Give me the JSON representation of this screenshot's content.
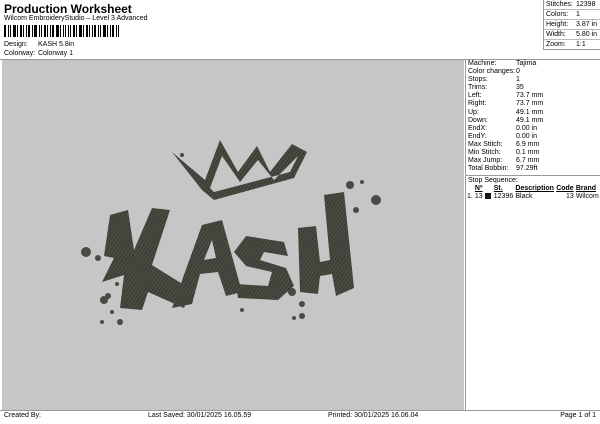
{
  "header": {
    "title": "Production Worksheet",
    "subtitle": "Wilcom EmbroideryStudio – Level 3 Advanced",
    "design_label": "Design:",
    "design_value": "KASH 5.8in",
    "colorway_label": "Colorway:",
    "colorway_value": "Colorway 1"
  },
  "stats": [
    {
      "label": "Stitches:",
      "value": "12398"
    },
    {
      "label": "Colors:",
      "value": "1"
    },
    {
      "label": "Height:",
      "value": "3.87 in"
    },
    {
      "label": "Width:",
      "value": "5.80 in"
    },
    {
      "label": "Zoom:",
      "value": "1:1"
    }
  ],
  "info": [
    {
      "label": "Machine:",
      "value": "Tajima"
    },
    {
      "label": "Color changes:",
      "value": "0"
    },
    {
      "label": "Stops:",
      "value": "1"
    },
    {
      "label": "Trims:",
      "value": "35"
    },
    {
      "label": "Left:",
      "value": "73.7 mm"
    },
    {
      "label": "Right:",
      "value": "73.7 mm"
    },
    {
      "label": "Up:",
      "value": "49.1 mm"
    },
    {
      "label": "Down:",
      "value": "49.1 mm"
    },
    {
      "label": "EndX:",
      "value": "0.00 in"
    },
    {
      "label": "EndY:",
      "value": "0.00 in"
    },
    {
      "label": "Max Stitch:",
      "value": "6.9 mm"
    },
    {
      "label": "Min Stitch:",
      "value": "0.1 mm"
    },
    {
      "label": "Max Jump:",
      "value": "6.7 mm"
    },
    {
      "label": "Total Bobbin:",
      "value": "97.29ft"
    }
  ],
  "stop_sequence": {
    "title": "Stop Sequence:",
    "headers": [
      "Nº",
      "St.",
      "Description",
      "Code",
      "Brand"
    ],
    "rows": [
      {
        "index": "1.",
        "n": "13",
        "st": "12396",
        "description": "Black",
        "code": "13",
        "brand": "Wilcom"
      }
    ],
    "swatch_color": "#1a1a1a"
  },
  "footer": {
    "created_by": "Created By:",
    "last_saved": "Last Saved: 30/01/2025 16.05.59",
    "printed": "Printed: 30/01/2025 16.06.04",
    "page": "Page 1 of 1"
  },
  "colors": {
    "preview_background": "#c6c6c6",
    "thread": "#4a4a42"
  }
}
